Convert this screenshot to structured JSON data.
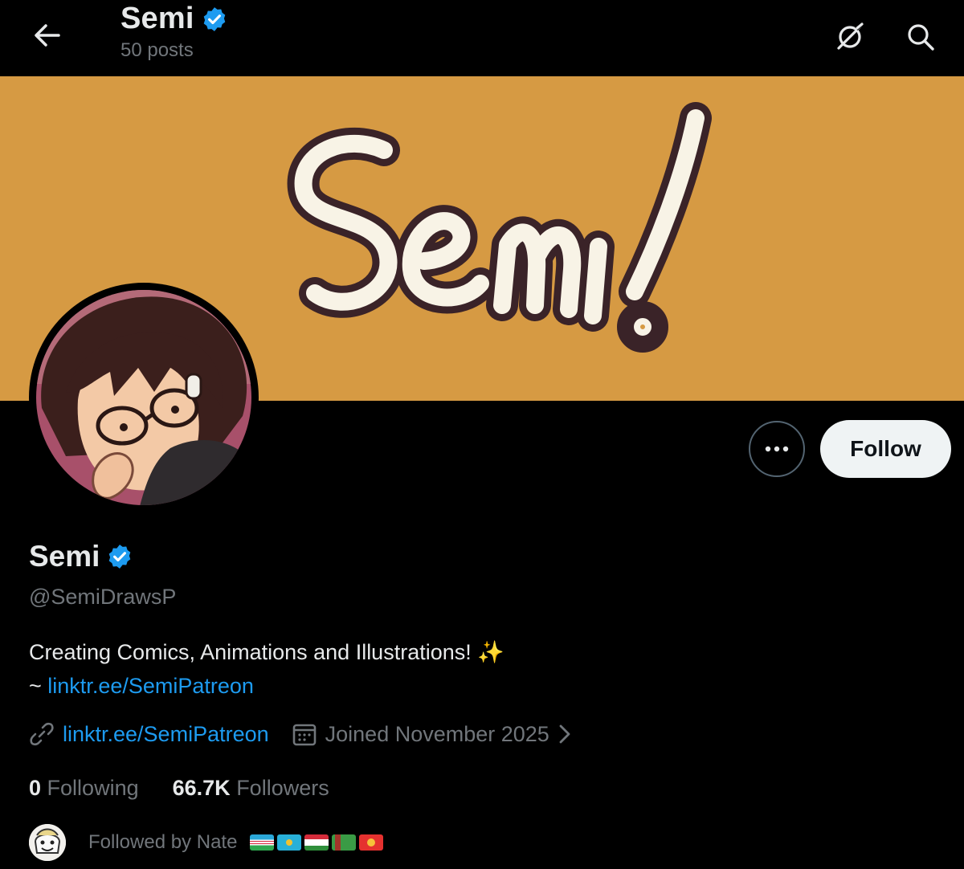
{
  "header": {
    "title": "Semi",
    "posts_count": "50 posts"
  },
  "banner": {
    "text": "Semi!",
    "background_color": "#d69a43"
  },
  "actions": {
    "more_label": "•••",
    "follow_label": "Follow"
  },
  "profile": {
    "display_name": "Semi",
    "handle": "@SemiDrawsP",
    "bio_line1": "Creating Comics, Animations and Illustrations! ✨",
    "bio_line2_prefix": "~",
    "bio_link": "linktr.ee/SemiPatreon",
    "website": "linktr.ee/SemiPatreon",
    "joined": "Joined November 2025"
  },
  "stats": {
    "following_count": "0",
    "following_label": "Following",
    "followers_count": "66.7K",
    "followers_label": "Followers"
  },
  "followed_by": {
    "text": "Followed by Nate"
  },
  "colors": {
    "verified": "#1d9bf0",
    "link": "#1d9bf0",
    "muted": "#71767b",
    "text": "#e7e9ea"
  }
}
